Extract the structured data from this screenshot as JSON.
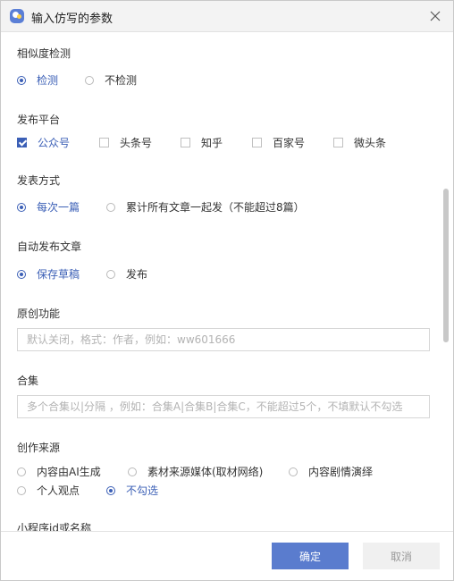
{
  "window": {
    "title": "输入仿写的参数",
    "icon": "app-logo-icon",
    "close_icon": "close-icon"
  },
  "accent_color": "#3b5fb6",
  "similarity": {
    "label": "相似度检测",
    "options": [
      {
        "label": "检测",
        "checked": true
      },
      {
        "label": "不检测",
        "checked": false
      }
    ]
  },
  "platform": {
    "label": "发布平台",
    "options": [
      {
        "label": "公众号",
        "checked": true
      },
      {
        "label": "头条号",
        "checked": false
      },
      {
        "label": "知乎",
        "checked": false
      },
      {
        "label": "百家号",
        "checked": false
      },
      {
        "label": "微头条",
        "checked": false
      }
    ]
  },
  "publish_mode": {
    "label": "发表方式",
    "options": [
      {
        "label": "每次一篇",
        "checked": true
      },
      {
        "label": "累计所有文章一起发（不能超过8篇）",
        "checked": false
      }
    ]
  },
  "auto_publish": {
    "label": "自动发布文章",
    "options": [
      {
        "label": "保存草稿",
        "checked": true
      },
      {
        "label": "发布",
        "checked": false
      }
    ]
  },
  "original": {
    "label": "原创功能",
    "value": "",
    "placeholder": "默认关闭，格式：作者，例如：ww601666"
  },
  "collection": {
    "label": "合集",
    "value": "",
    "placeholder": "多个合集以|分隔 ，例如：合集A|合集B|合集C，不能超过5个，不填默认不勾选"
  },
  "source": {
    "label": "创作来源",
    "options": [
      {
        "label": "内容由AI生成",
        "checked": false
      },
      {
        "label": "素材来源媒体(取材网络)",
        "checked": false
      },
      {
        "label": "内容剧情演绎",
        "checked": false
      },
      {
        "label": "个人观点",
        "checked": false
      },
      {
        "label": "不勾选",
        "checked": true
      }
    ]
  },
  "mini_program": {
    "label": "小程序id或名称"
  },
  "footer": {
    "confirm_label": "确定",
    "cancel_label": "取消"
  }
}
